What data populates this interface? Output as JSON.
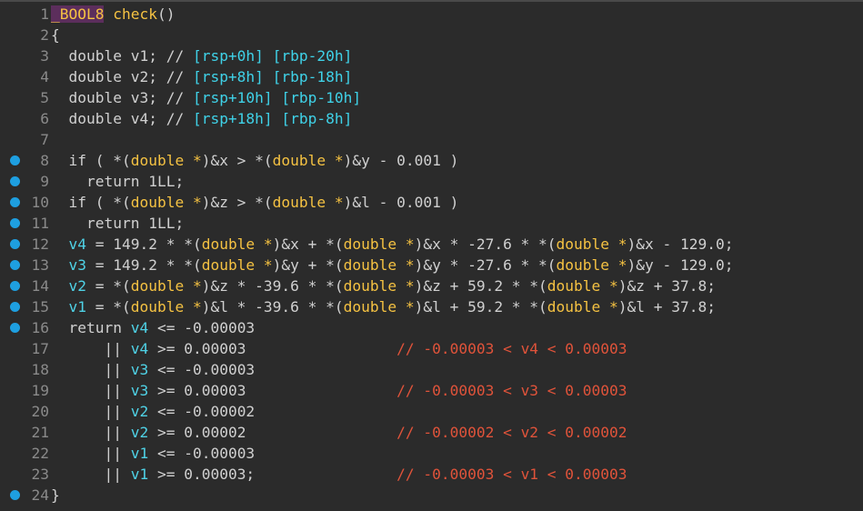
{
  "lines": [
    {
      "n": "1",
      "bp": false,
      "indent": "",
      "t": [
        {
          "c": "mac",
          "s": "_BOOL8"
        },
        {
          "c": "",
          "s": " "
        },
        {
          "c": "fn",
          "s": "check"
        },
        {
          "c": "",
          "s": "()"
        }
      ]
    },
    {
      "n": "2",
      "bp": false,
      "indent": "",
      "t": [
        {
          "c": "",
          "s": "{"
        }
      ]
    },
    {
      "n": "3",
      "bp": false,
      "indent": "  ",
      "t": [
        {
          "c": "",
          "s": "double v1; // "
        },
        {
          "c": "reg",
          "s": "[rsp+0h] [rbp-20h]"
        }
      ]
    },
    {
      "n": "4",
      "bp": false,
      "indent": "  ",
      "t": [
        {
          "c": "",
          "s": "double v2; // "
        },
        {
          "c": "reg",
          "s": "[rsp+8h] [rbp-18h]"
        }
      ]
    },
    {
      "n": "5",
      "bp": false,
      "indent": "  ",
      "t": [
        {
          "c": "",
          "s": "double v3; // "
        },
        {
          "c": "reg",
          "s": "[rsp+10h] [rbp-10h]"
        }
      ]
    },
    {
      "n": "6",
      "bp": false,
      "indent": "  ",
      "t": [
        {
          "c": "",
          "s": "double v4; // "
        },
        {
          "c": "reg",
          "s": "[rsp+18h] [rbp-8h]"
        }
      ]
    },
    {
      "n": "7",
      "bp": false,
      "indent": "",
      "t": []
    },
    {
      "n": "8",
      "bp": true,
      "indent": "  ",
      "t": [
        {
          "c": "",
          "s": "if ( *("
        },
        {
          "c": "typ",
          "s": "double *"
        },
        {
          "c": "",
          "s": ")&x > *("
        },
        {
          "c": "typ",
          "s": "double *"
        },
        {
          "c": "",
          "s": ")&y - 0.001 )"
        }
      ]
    },
    {
      "n": "9",
      "bp": true,
      "indent": "    ",
      "t": [
        {
          "c": "",
          "s": "return 1LL;"
        }
      ]
    },
    {
      "n": "10",
      "bp": true,
      "indent": "  ",
      "t": [
        {
          "c": "",
          "s": "if ( *("
        },
        {
          "c": "typ",
          "s": "double *"
        },
        {
          "c": "",
          "s": ")&z > *("
        },
        {
          "c": "typ",
          "s": "double *"
        },
        {
          "c": "",
          "s": ")&l - 0.001 )"
        }
      ]
    },
    {
      "n": "11",
      "bp": true,
      "indent": "    ",
      "t": [
        {
          "c": "",
          "s": "return 1LL;"
        }
      ]
    },
    {
      "n": "12",
      "bp": true,
      "indent": "  ",
      "t": [
        {
          "c": "var",
          "s": "v4"
        },
        {
          "c": "",
          "s": " = 149.2 * *("
        },
        {
          "c": "typ",
          "s": "double *"
        },
        {
          "c": "",
          "s": ")&x + *("
        },
        {
          "c": "typ",
          "s": "double *"
        },
        {
          "c": "",
          "s": ")&x * -27.6 * *("
        },
        {
          "c": "typ",
          "s": "double *"
        },
        {
          "c": "",
          "s": ")&x - 129.0;"
        }
      ]
    },
    {
      "n": "13",
      "bp": true,
      "indent": "  ",
      "t": [
        {
          "c": "var",
          "s": "v3"
        },
        {
          "c": "",
          "s": " = 149.2 * *("
        },
        {
          "c": "typ",
          "s": "double *"
        },
        {
          "c": "",
          "s": ")&y + *("
        },
        {
          "c": "typ",
          "s": "double *"
        },
        {
          "c": "",
          "s": ")&y * -27.6 * *("
        },
        {
          "c": "typ",
          "s": "double *"
        },
        {
          "c": "",
          "s": ")&y - 129.0;"
        }
      ]
    },
    {
      "n": "14",
      "bp": true,
      "indent": "  ",
      "t": [
        {
          "c": "var",
          "s": "v2"
        },
        {
          "c": "",
          "s": " = *("
        },
        {
          "c": "typ",
          "s": "double *"
        },
        {
          "c": "",
          "s": ")&z * -39.6 * *("
        },
        {
          "c": "typ",
          "s": "double *"
        },
        {
          "c": "",
          "s": ")&z + 59.2 * *("
        },
        {
          "c": "typ",
          "s": "double *"
        },
        {
          "c": "",
          "s": ")&z + 37.8;"
        }
      ]
    },
    {
      "n": "15",
      "bp": true,
      "indent": "  ",
      "t": [
        {
          "c": "var",
          "s": "v1"
        },
        {
          "c": "",
          "s": " = *("
        },
        {
          "c": "typ",
          "s": "double *"
        },
        {
          "c": "",
          "s": ")&l * -39.6 * *("
        },
        {
          "c": "typ",
          "s": "double *"
        },
        {
          "c": "",
          "s": ")&l + 59.2 * *("
        },
        {
          "c": "typ",
          "s": "double *"
        },
        {
          "c": "",
          "s": ")&l + 37.8;"
        }
      ]
    },
    {
      "n": "16",
      "bp": true,
      "indent": "  ",
      "t": [
        {
          "c": "",
          "s": "return "
        },
        {
          "c": "var",
          "s": "v4"
        },
        {
          "c": "",
          "s": " <= -0.00003"
        }
      ]
    },
    {
      "n": "17",
      "bp": false,
      "indent": "      ",
      "t": [
        {
          "c": "",
          "s": "|| "
        },
        {
          "c": "var",
          "s": "v4"
        },
        {
          "c": "",
          "s": " >= 0.00003                 "
        },
        {
          "c": "cmt",
          "s": "// -0.00003 < v4 < 0.00003"
        }
      ]
    },
    {
      "n": "18",
      "bp": false,
      "indent": "      ",
      "t": [
        {
          "c": "",
          "s": "|| "
        },
        {
          "c": "var",
          "s": "v3"
        },
        {
          "c": "",
          "s": " <= -0.00003"
        }
      ]
    },
    {
      "n": "19",
      "bp": false,
      "indent": "      ",
      "t": [
        {
          "c": "",
          "s": "|| "
        },
        {
          "c": "var",
          "s": "v3"
        },
        {
          "c": "",
          "s": " >= 0.00003                 "
        },
        {
          "c": "cmt",
          "s": "// -0.00003 < v3 < 0.00003"
        }
      ]
    },
    {
      "n": "20",
      "bp": false,
      "indent": "      ",
      "t": [
        {
          "c": "",
          "s": "|| "
        },
        {
          "c": "var",
          "s": "v2"
        },
        {
          "c": "",
          "s": " <= -0.00002"
        }
      ]
    },
    {
      "n": "21",
      "bp": false,
      "indent": "      ",
      "t": [
        {
          "c": "",
          "s": "|| "
        },
        {
          "c": "var",
          "s": "v2"
        },
        {
          "c": "",
          "s": " >= 0.00002                 "
        },
        {
          "c": "cmt",
          "s": "// -0.00002 < v2 < 0.00002"
        }
      ]
    },
    {
      "n": "22",
      "bp": false,
      "indent": "      ",
      "t": [
        {
          "c": "",
          "s": "|| "
        },
        {
          "c": "var",
          "s": "v1"
        },
        {
          "c": "",
          "s": " <= -0.00003"
        }
      ]
    },
    {
      "n": "23",
      "bp": false,
      "indent": "      ",
      "t": [
        {
          "c": "",
          "s": "|| "
        },
        {
          "c": "var",
          "s": "v1"
        },
        {
          "c": "",
          "s": " >= 0.00003;                "
        },
        {
          "c": "cmt",
          "s": "// -0.00003 < v1 < 0.00003"
        }
      ]
    },
    {
      "n": "24",
      "bp": true,
      "indent": "",
      "t": [
        {
          "c": "",
          "s": "}"
        }
      ]
    }
  ]
}
